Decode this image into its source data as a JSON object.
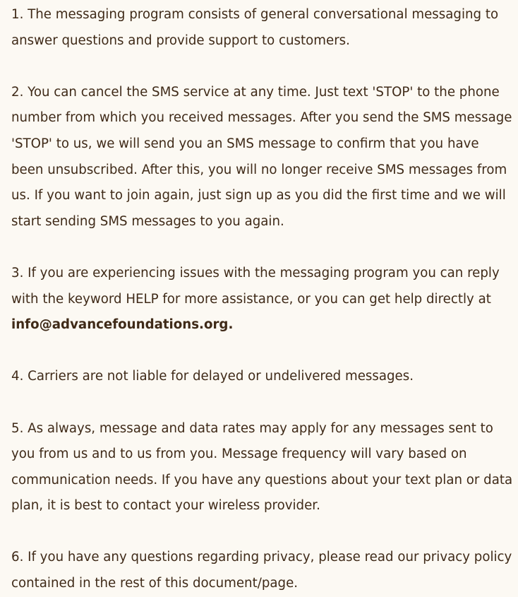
{
  "terms": {
    "p1": "1. The messaging program consists of general conversational messaging to answer questions and provide support to customers.",
    "p2": "2. You can cancel the SMS service at any time. Just text 'STOP' to the phone number from which you received messages. After you send the SMS message 'STOP' to us, we will send you an SMS message to confirm that you have been unsubscribed. After this, you will no longer receive SMS messages from us. If you want to join again, just sign up as you did the first time and we will start sending SMS messages to you again.",
    "p3_text": "3. If you are experiencing issues with the messaging program you can reply with the keyword HELP for more assistance, or you can get help directly at ",
    "p3_email": "info@advancefoundations.org.",
    "p4": "4. Carriers are not liable for delayed or undelivered messages.",
    "p5": "5. As always, message and data rates may apply for any messages sent to you from us and to us from you. Message frequency will vary based on communication needs. If you have any questions about your text plan or data plan, it is best to contact your wireless provider.",
    "p6": "6. If you have any questions regarding privacy, please read our privacy policy contained in the rest of this document/page."
  },
  "colors": {
    "background": "#fcf9f3",
    "text": "#3f2a18"
  }
}
